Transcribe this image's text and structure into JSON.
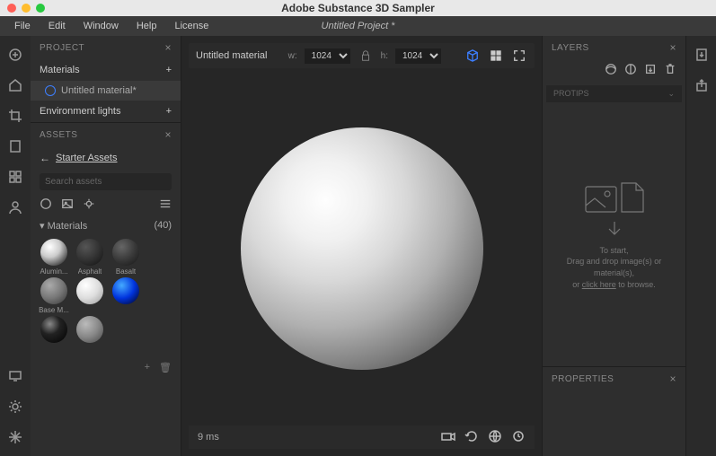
{
  "app_title": "Adobe Substance 3D Sampler",
  "project_title": "Untitled Project *",
  "menu": {
    "file": "File",
    "edit": "Edit",
    "window": "Window",
    "help": "Help",
    "license": "License"
  },
  "left_rail": {
    "add": "add-icon",
    "home": "home-icon",
    "crop": "crop-icon",
    "page": "page-icon",
    "grid": "grid-icon",
    "user": "user-icon",
    "monitor": "monitor-icon",
    "cog": "cog-icon",
    "snow": "snowflake-icon"
  },
  "project_panel": {
    "title": "PROJECT",
    "materials_label": "Materials",
    "material_name": "Untitled material*",
    "env_label": "Environment lights"
  },
  "assets_panel": {
    "title": "ASSETS",
    "breadcrumb": "Starter Assets",
    "search_placeholder": "Search assets",
    "category_label": "Materials",
    "category_count": "(40)",
    "thumbs": [
      {
        "name": "Alumin..."
      },
      {
        "name": "Asphalt"
      },
      {
        "name": "Basalt"
      },
      {
        "name": "Base M..."
      },
      {
        "name": ""
      },
      {
        "name": ""
      },
      {
        "name": ""
      },
      {
        "name": ""
      }
    ]
  },
  "viewport": {
    "material_name": "Untitled material",
    "w_label": "w:",
    "w_value": "1024",
    "h_label": "h:",
    "h_value": "1024",
    "render_time": "9 ms"
  },
  "layers_panel": {
    "title": "LAYERS",
    "section": "PROTIPS",
    "empty_line1": "To start,",
    "empty_line2": "Drag and drop image(s) or material(s),",
    "empty_line3_a": "or ",
    "empty_link": "click here",
    "empty_line3_b": " to browse."
  },
  "properties_panel": {
    "title": "PROPERTIES"
  },
  "right_rail": {
    "export": "export-icon",
    "share": "share-icon"
  }
}
